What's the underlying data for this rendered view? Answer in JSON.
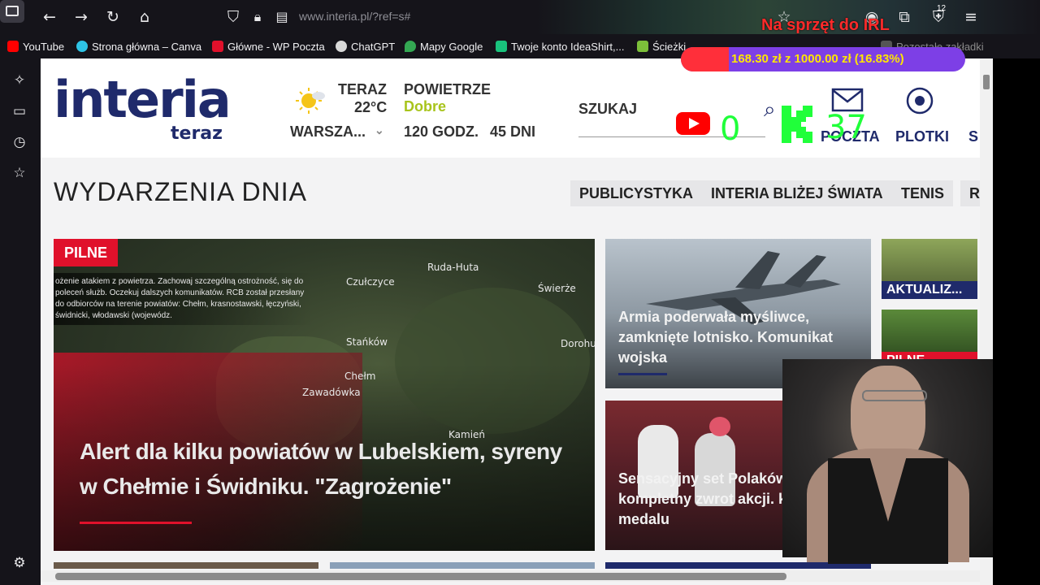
{
  "browser": {
    "url": "www.interia.pl/?ref=s#",
    "extensions_badge": "12",
    "bookmarks": [
      {
        "label": "YouTube",
        "color": "#ff0000"
      },
      {
        "label": "Strona główna – Canva",
        "color": "#2ec4e6"
      },
      {
        "label": "Główne - WP Poczta",
        "color": "#e0112b"
      },
      {
        "label": "ChatGPT",
        "color": "#ffffff"
      },
      {
        "label": "Mapy Google",
        "color": "#34a853"
      },
      {
        "label": "Twoje konto IdeaShirt,...",
        "color": "#19c37d"
      },
      {
        "label": "Ścieżki",
        "color": "#7cbf3a"
      },
      {
        "label": "Pozostałe zakładki",
        "color": "#888888"
      }
    ]
  },
  "header": {
    "logo": "interia",
    "logo_sub": "teraz",
    "weather_now_label": "TERAZ",
    "temperature": "22°C",
    "city": "WARSZA...",
    "air_label": "POWIETRZE",
    "air_quality": "Dobre",
    "forecast_hours": "120 GODZ.",
    "forecast_days": "45 DNI",
    "search_label": "SZUKAJ",
    "nav_mail": "POCZTA",
    "nav_gossip": "PLOTKI",
    "nav_more": "S"
  },
  "section": {
    "title": "WYDARZENIA DNIA",
    "chips": [
      "PUBLICYSTYKA",
      "INTERIA BLIŻEJ ŚWIATA",
      "TENIS",
      "R"
    ]
  },
  "hero": {
    "badge": "PILNE",
    "title": "Alert dla kilku powiatów w Lubelskiem, syreny w Chełmie i Świdniku. \"Zagrożenie\"",
    "overlay_text": "ożenie atakiem z powietrza. Zachowaj szczególną ostrożność, się do poleceń służb. Oczekuj dalszych komunikatów. RCB został przesłany do odbiorców na terenie powiatów: Chełm, krasnostawski, łęczyński, świdnicki, włodawski (wojewódz.",
    "map_labels": [
      "Ruda-Huta",
      "Czułczyce",
      "Świerże",
      "Stańków",
      "Dorohu",
      "Chełm",
      "Zawadówka",
      "Kamień"
    ]
  },
  "cards": [
    {
      "title": "Armia poderwała myśliwce, zamknięte lotnisko. Komunikat wojska"
    },
    {
      "title": "Sensacyjny set Polaków, kompletny zwrot akcji. krok do medalu"
    }
  ],
  "thumbs": [
    {
      "label": "AKTUALIZ..."
    },
    {
      "label": "PILNE"
    }
  ],
  "overlays": {
    "stream_goal": "Na sprzęt do IRL",
    "donation_text": "168.30 zł z 1000.00 zł (16.83%)",
    "donation_progress": 0.1683,
    "youtube_viewers": "0",
    "kick_viewers": "37"
  }
}
